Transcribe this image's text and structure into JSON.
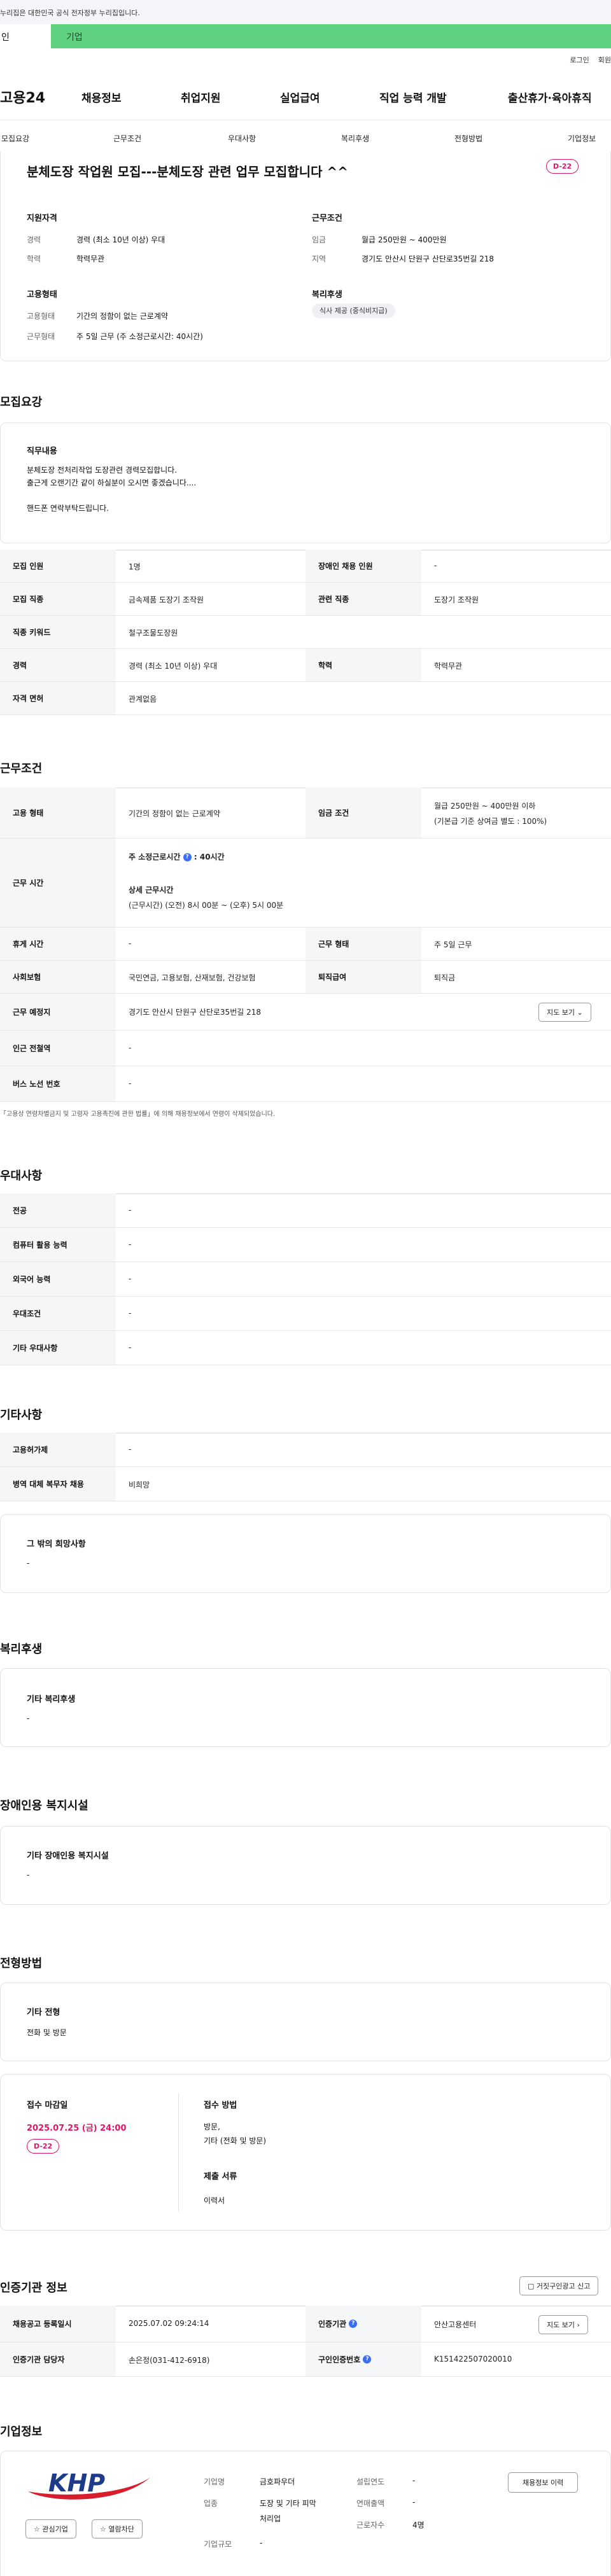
{
  "gov_notice": "누리집은 대한민국 공식 전자정부 누리집입니다.",
  "tabs": {
    "person": "인",
    "company": "기업"
  },
  "utility": {
    "login": "로그인",
    "join": "회원"
  },
  "gnb": {
    "logo": "고용24",
    "items": [
      "채용정보",
      "취업지원",
      "실업급여",
      "직업 능력 개발",
      "출산휴가·육아휴직"
    ]
  },
  "subnav": [
    "모집요강",
    "근무조건",
    "우대사항",
    "복리후생",
    "전형방법",
    "기업정보"
  ],
  "summary": {
    "title": "분체도장 작업원 모집---분체도장 관련 업무 모집합니다 ^^",
    "dday": "D-22",
    "qualification": {
      "heading": "지원자격",
      "career_k": "경력",
      "career_v": "경력 (최소 10년 이상) 우대",
      "edu_k": "학력",
      "edu_v": "학력무관"
    },
    "conditions": {
      "heading": "근무조건",
      "wage_k": "임금",
      "wage_v": "월급 250만원 ~ 400만원",
      "region_k": "지역",
      "region_v": "경기도 안산시 단원구 산단로35번길 218"
    },
    "employment": {
      "heading": "고용형태",
      "type_k": "고용형태",
      "type_v": "기간의 정함이 없는 근로계약",
      "hours_k": "근무형태",
      "hours_v": "주 5일 근무 (주 소정근로시간: 40시간)"
    },
    "welfare": {
      "heading": "복리후생",
      "badge": "식사 제공 (중식비지급)"
    }
  },
  "recruit": {
    "section_title": "모집요강",
    "duty_heading": "직무내용",
    "duty_lines": [
      "분체도장 전처리작업 도장관련 경력모집합니다.",
      "출근게 오랜기간 같이 하실분이 오시면 좋겠습니다....",
      "",
      "핸드폰 연락부탁드립니다."
    ],
    "table": {
      "headcount_k": "모집 인원",
      "headcount_v": "1명",
      "disabled_k": "장애인 채용 인원",
      "disabled_v": "-",
      "job_k": "모집 직종",
      "job_v": "금속제품 도장기 조작원",
      "related_k": "관련 직종",
      "related_v": "도장기 조작원",
      "keyword_k": "직종 키워드",
      "keyword_v": "철구조물도장원",
      "career_k": "경력",
      "career_v": "경력 (최소 10년 이상) 우대",
      "edu_k": "학력",
      "edu_v": "학력무관",
      "license_k": "자격 면허",
      "license_v": "관계없음"
    }
  },
  "work": {
    "section_title": "근무조건",
    "type_k": "고용 형태",
    "type_v": "기간의 정함이 없는 근로계약",
    "wage_k": "임금 조건",
    "wage_v1": "월급 250만원 ~ 400만원 이하",
    "wage_v2": "(기본급 기준 상여금 별도 : 100%)",
    "hours_k": "근무 시간",
    "hours_label": "주 소정근로시간",
    "hours_value": "40시간",
    "detail_label": "상세 근무시간",
    "detail_value": "(근무시간) (오전) 8시 00분 ~ (오후) 5시 00분",
    "break_k": "휴게 시간",
    "break_v": "-",
    "form_k": "근무 형태",
    "form_v": "주 5일 근무",
    "insurance_k": "사회보험",
    "insurance_v": "국민연금, 고용보험, 산재보험, 건강보험",
    "severance_k": "퇴직급여",
    "severance_v": "퇴직금",
    "place_k": "근무 예정지",
    "place_v": "경기도 안산시 단원구 산단로35번길 218",
    "map_btn": "지도 보기",
    "station_k": "인근 전철역",
    "station_v": "-",
    "bus_k": "버스 노선 번호",
    "bus_v": "-",
    "note": "「고용상 연령차별금지 및 고령자 고용촉진에 관한 법률」에 의해 채용정보에서 연령이 삭제되었습니다."
  },
  "prefer": {
    "section_title": "우대사항",
    "rows": [
      {
        "k": "전공",
        "v": "-"
      },
      {
        "k": "컴퓨터 활용 능력",
        "v": "-"
      },
      {
        "k": "외국어 능력",
        "v": "-"
      },
      {
        "k": "우대조건",
        "v": "-"
      },
      {
        "k": "기타 우대사항",
        "v": "-"
      }
    ]
  },
  "etc": {
    "section_title": "기타사항",
    "rows": [
      {
        "k": "고용허가제",
        "v": "-"
      },
      {
        "k": "병역 대체 복무자 채용",
        "v": "비희망"
      }
    ],
    "other_heading": "그 밖의 희망사항",
    "other_value": "-"
  },
  "benefit": {
    "section_title": "복리후생",
    "heading": "기타 복리후생",
    "value": "-"
  },
  "disabled": {
    "section_title": "장애인용 복지시설",
    "heading": "기타 장애인용 복지시설",
    "value": "-"
  },
  "screening": {
    "section_title": "전형방법",
    "heading": "기타 전형",
    "value": "전화 및 방문",
    "deadline_label": "접수 마감일",
    "deadline_value": "2025.07.25 (금) 24:00",
    "deadline_dday": "D-22",
    "method_label": "접수 방법",
    "method_v1": "방문,",
    "method_v2": "기타 (전화 및 방문)",
    "docs_label": "제출 서류",
    "docs_value": "이력서"
  },
  "agency": {
    "section_title": "인증기관 정보",
    "report_btn": "거짓구인광고 신고",
    "reg_k": "채용공고 등록일시",
    "reg_v": "2025.07.02 09:24:14",
    "org_k": "인증기관",
    "org_v": "안산고용센터",
    "map_btn": "지도 보기",
    "manager_k": "인증기관 담당자",
    "manager_v": "손은정(031-412-6918)",
    "id_k": "구인인증번호",
    "id_v": "K151422507020010"
  },
  "company": {
    "section_title": "기업정보",
    "logo_text": "KHP",
    "interest_btn": "관심기업",
    "block_btn": "열람차단",
    "name_k": "기업명",
    "name_v": "금호파우더",
    "industry_k": "업종",
    "industry_v1": "도장 및 기타 피막",
    "industry_v2": "처리업",
    "size_k": "기업규모",
    "size_v": "-",
    "founded_k": "설립연도",
    "founded_v": "-",
    "sales_k": "연매출액",
    "sales_v": "-",
    "employees_k": "근로자수",
    "employees_v": "4명",
    "jobs_btn": "채용정보 이력"
  },
  "colors": {
    "accent_green": "#5fd17f",
    "dday_pink": "#e0156b",
    "info_blue": "#3b6ef5",
    "logo_blue": "#1e3a8a",
    "logo_red": "#d81e2c"
  }
}
